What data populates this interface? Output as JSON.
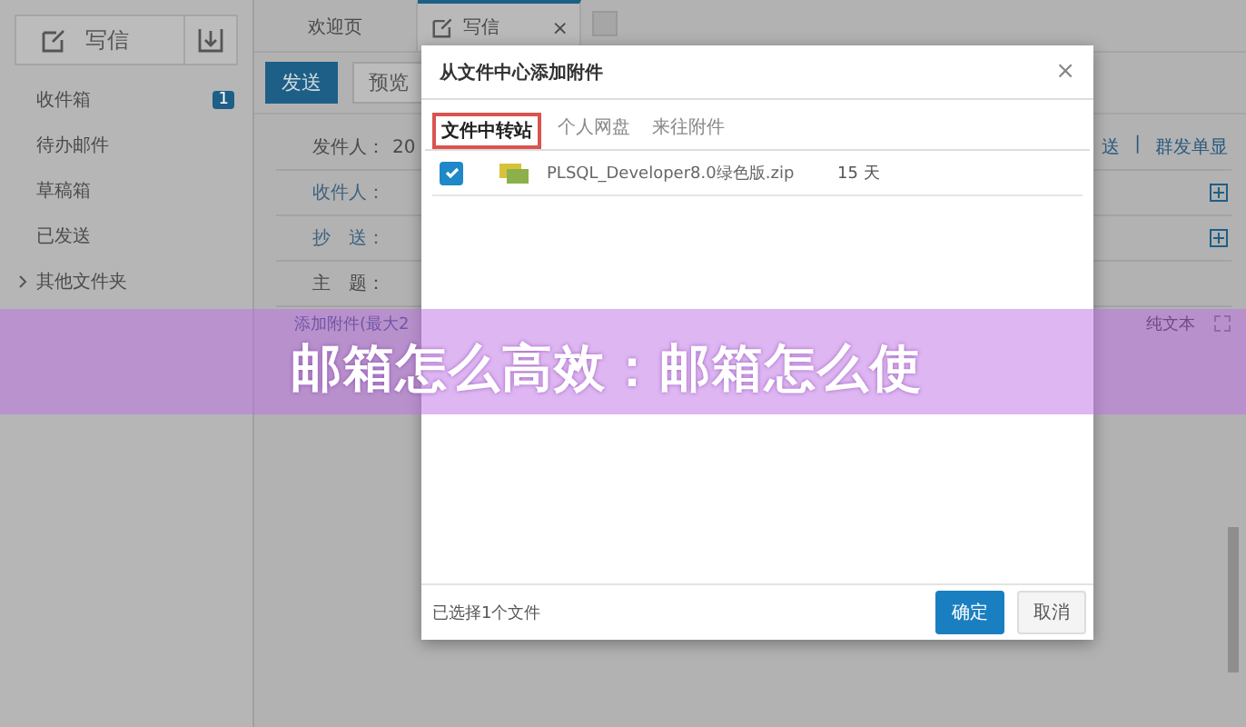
{
  "sidebar": {
    "compose_label": "写信",
    "folders": [
      {
        "label": "收件箱",
        "badge": "1",
        "expandable": false
      },
      {
        "label": "待办邮件",
        "expandable": false
      },
      {
        "label": "草稿箱",
        "expandable": false
      },
      {
        "label": "已发送",
        "expandable": false
      },
      {
        "label": "其他文件夹",
        "expandable": true
      }
    ]
  },
  "tabs": [
    {
      "label": "欢迎页",
      "selected": false,
      "closable": false
    },
    {
      "label": "写信",
      "selected": true,
      "closable": true,
      "close": "×"
    }
  ],
  "toolbar": {
    "buttons": [
      {
        "label": "发送",
        "kind": "primary"
      },
      {
        "label": "预览",
        "kind": "plain"
      }
    ]
  },
  "form": {
    "fields": [
      {
        "label": "发件人：",
        "value": "20",
        "add": false
      },
      {
        "label": "收件人：",
        "add": true
      },
      {
        "label": "抄　送：",
        "add": true
      },
      {
        "label": "主　题：",
        "add": false
      }
    ],
    "links": [
      "送",
      "|",
      "群发单显"
    ],
    "attach": "添加附件(最大2",
    "plain_text": "纯文本"
  },
  "dialog": {
    "title": "从文件中心添加附件",
    "close": "×",
    "tabs": [
      {
        "label": "文件中转站",
        "selected": true
      },
      {
        "label": "个人网盘",
        "selected": false
      },
      {
        "label": "来往附件",
        "selected": false
      }
    ],
    "files": [
      {
        "name": "PLSQL_Developer8.0绿色版.zip",
        "days": "15 天",
        "checked": true
      }
    ],
    "status": "已选择1个文件",
    "ok": "确定",
    "cancel": "取消"
  },
  "banner": {
    "title": "邮箱怎么高效：邮箱怎么使"
  }
}
